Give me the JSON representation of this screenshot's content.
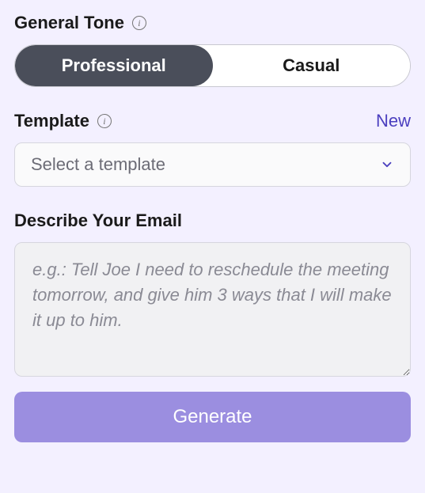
{
  "tone": {
    "label": "General Tone",
    "options": [
      "Professional",
      "Casual"
    ],
    "selected": 0
  },
  "template": {
    "label": "Template",
    "new_link": "New",
    "placeholder": "Select a template",
    "selected": null
  },
  "describe": {
    "label": "Describe Your Email",
    "placeholder": "e.g.: Tell Joe I need to reschedule the meeting tomorrow, and give him 3 ways that I will make it up to him.",
    "value": ""
  },
  "generate_button": "Generate"
}
